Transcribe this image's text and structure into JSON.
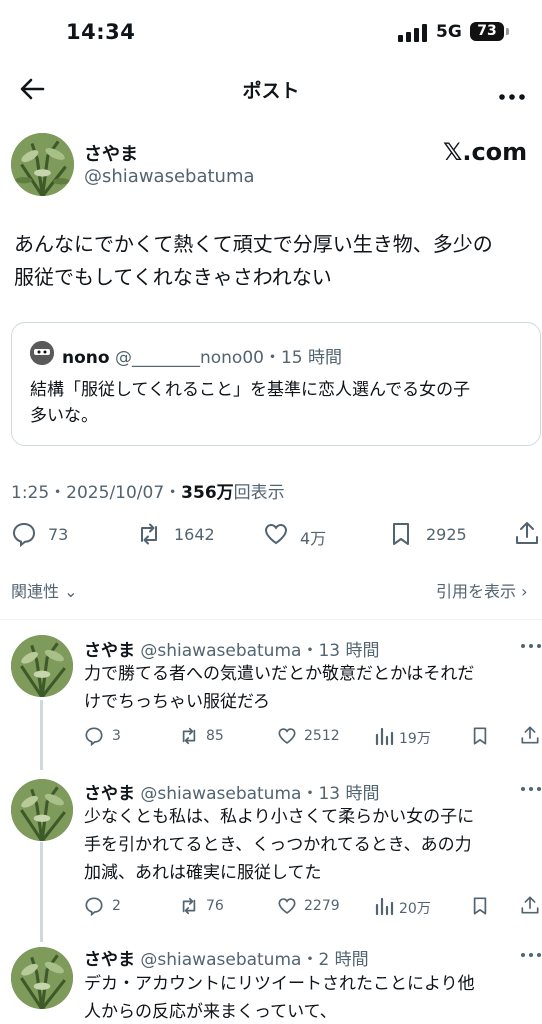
{
  "status_bar": {
    "time": "14:34",
    "network": "5G",
    "battery": "73"
  },
  "header": {
    "title": "ポスト"
  },
  "post": {
    "author_name": "さやま",
    "author_handle": "@shiawasebatuma",
    "watermark": "𝕏.com",
    "text_line1": "あんなにでかくて熱くて頑丈で分厚い生き物、多少の",
    "text_line2": "服従でもしてくれなきゃさわれない",
    "quote": {
      "name": "nono",
      "meta": " @________nono00・15 時間",
      "text_line1": "結構「服従してくれること」を基準に恋人選んでる女の子",
      "text_line2": "多いな。"
    },
    "meta_prefix": "1:25・2025/10/07・",
    "views": "356万",
    "views_suffix": "回表示",
    "stats": {
      "replies": "73",
      "reposts": "1642",
      "likes": "4万",
      "bookmarks": "2925"
    }
  },
  "sort": {
    "label": "関連性 ⌄",
    "quotes_link": "引用を表示 ›"
  },
  "replies": [
    {
      "name": "さやま",
      "meta": " @shiawasebatuma・13 時間",
      "line1": "力で勝てる者への気遣いだとか敬意だとかはそれだ",
      "line2": "けでちっちゃい服従だろ",
      "line3": "",
      "replies": "3",
      "reposts": "85",
      "likes": "2512",
      "views": "19万"
    },
    {
      "name": "さやま",
      "meta": " @shiawasebatuma・13 時間",
      "line1": "少なくとも私は、私より小さくて柔らかい女の子に",
      "line2": "手を引かれてるとき、くっつかれてるとき、あの力",
      "line3": "加減、あれは確実に服従してた",
      "replies": "2",
      "reposts": "76",
      "likes": "2279",
      "views": "20万"
    },
    {
      "name": "さやま",
      "meta": " @shiawasebatuma・2 時間",
      "line1": "デカ・アカウントにリツイートされたことにより他",
      "line2": "人からの反応が来まくっていて、",
      "line3": ""
    }
  ],
  "icons": [
    "back-arrow-icon",
    "more-icon",
    "reply-icon",
    "repost-icon",
    "like-icon",
    "bookmark-icon",
    "share-icon",
    "views-icon"
  ]
}
